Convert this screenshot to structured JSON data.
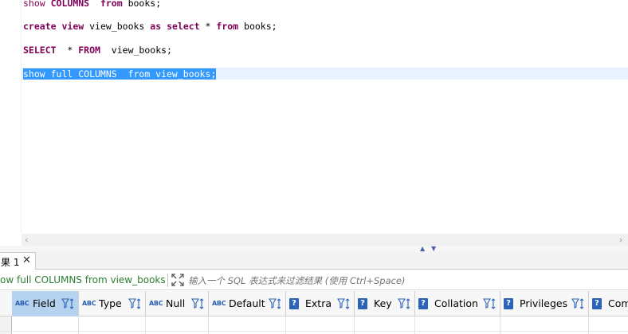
{
  "editor": {
    "lines": [
      {
        "parts": [
          {
            "t": "show ",
            "c": "kw2"
          },
          {
            "t": "COLUMNS",
            "c": "kw"
          },
          {
            "t": "  "
          },
          {
            "t": "from",
            "c": "kw"
          },
          {
            "t": " books;"
          }
        ]
      },
      {
        "parts": [
          {
            "t": "create",
            "c": "kw"
          },
          {
            "t": " "
          },
          {
            "t": "view",
            "c": "kw"
          },
          {
            "t": " view_books "
          },
          {
            "t": "as",
            "c": "kw"
          },
          {
            "t": " "
          },
          {
            "t": "select",
            "c": "kw"
          },
          {
            "t": " * "
          },
          {
            "t": "from",
            "c": "kw"
          },
          {
            "t": " books;"
          }
        ]
      },
      {
        "parts": [
          {
            "t": "SELECT",
            "c": "kw"
          },
          {
            "t": "  * "
          },
          {
            "t": "FROM",
            "c": "kw"
          },
          {
            "t": "  view_books;"
          }
        ]
      },
      {
        "parts": [
          {
            "t": "show full COLUMNS  from view_books;"
          }
        ],
        "selected": true
      }
    ]
  },
  "results": {
    "tab_label": "果 1",
    "close_glyph": "✕",
    "query_label": "ow full COLUMNS from view_books",
    "filter_placeholder": "输入一个 SQL 表达式来过滤结果 (使用 Ctrl+Space)",
    "splitter": {
      "up_glyph": "▲",
      "down_glyph": "▼"
    },
    "columns": [
      {
        "name": "Field",
        "icon": "abc-text-icon",
        "active": true
      },
      {
        "name": "Type",
        "icon": "abc-text-icon"
      },
      {
        "name": "Null",
        "icon": "abc-text-icon"
      },
      {
        "name": "Default",
        "icon": "abc-text-icon"
      },
      {
        "name": "Extra",
        "icon": "question-icon"
      },
      {
        "name": "Key",
        "icon": "question-icon"
      },
      {
        "name": "Collation",
        "icon": "question-icon"
      },
      {
        "name": "Privileges",
        "icon": "question-icon"
      },
      {
        "name": "Com",
        "icon": "question-icon"
      }
    ]
  },
  "colors": {
    "accent": "#3399ff",
    "keyword": "#7f0055",
    "query_label": "#2e7d32",
    "icon_blue": "#2a63b8"
  }
}
